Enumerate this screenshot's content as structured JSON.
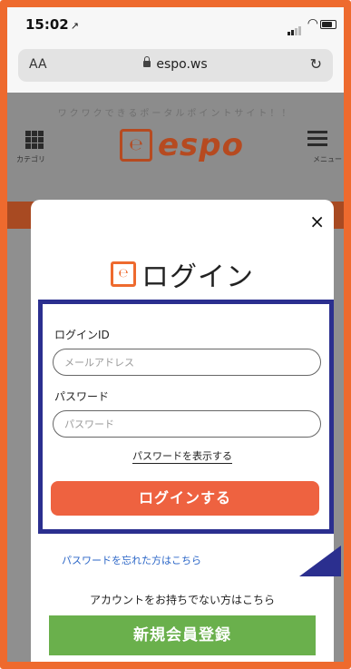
{
  "status_bar": {
    "time": "15:02",
    "location_arrow": "↗"
  },
  "browser": {
    "text_size_label": "AA",
    "url": "espo.ws",
    "reload_icon": "reload-icon"
  },
  "site": {
    "tagline": "ワクワクできるポータルポイントサイト！！",
    "category_label": "カテゴリ",
    "logo_text": "espo",
    "menu_label": "メニュー"
  },
  "modal": {
    "close_label": "×",
    "title": "ログイン",
    "login_id_label": "ログインID",
    "email_placeholder": "メールアドレス",
    "password_label": "パスワード",
    "password_placeholder": "パスワード",
    "show_password_label": "パスワードを表示する",
    "login_button": "ログインする",
    "forgot_password_link": "パスワードを忘れた方はこちら",
    "no_account_text": "アカウントをお持ちでない方はこちら",
    "register_button": "新規会員登録"
  },
  "colors": {
    "frame": "#ee6a2e",
    "login_button": "#ee6240",
    "register_button": "#6ab04c",
    "highlight": "#2b2f8f",
    "link": "#2b66c7"
  }
}
